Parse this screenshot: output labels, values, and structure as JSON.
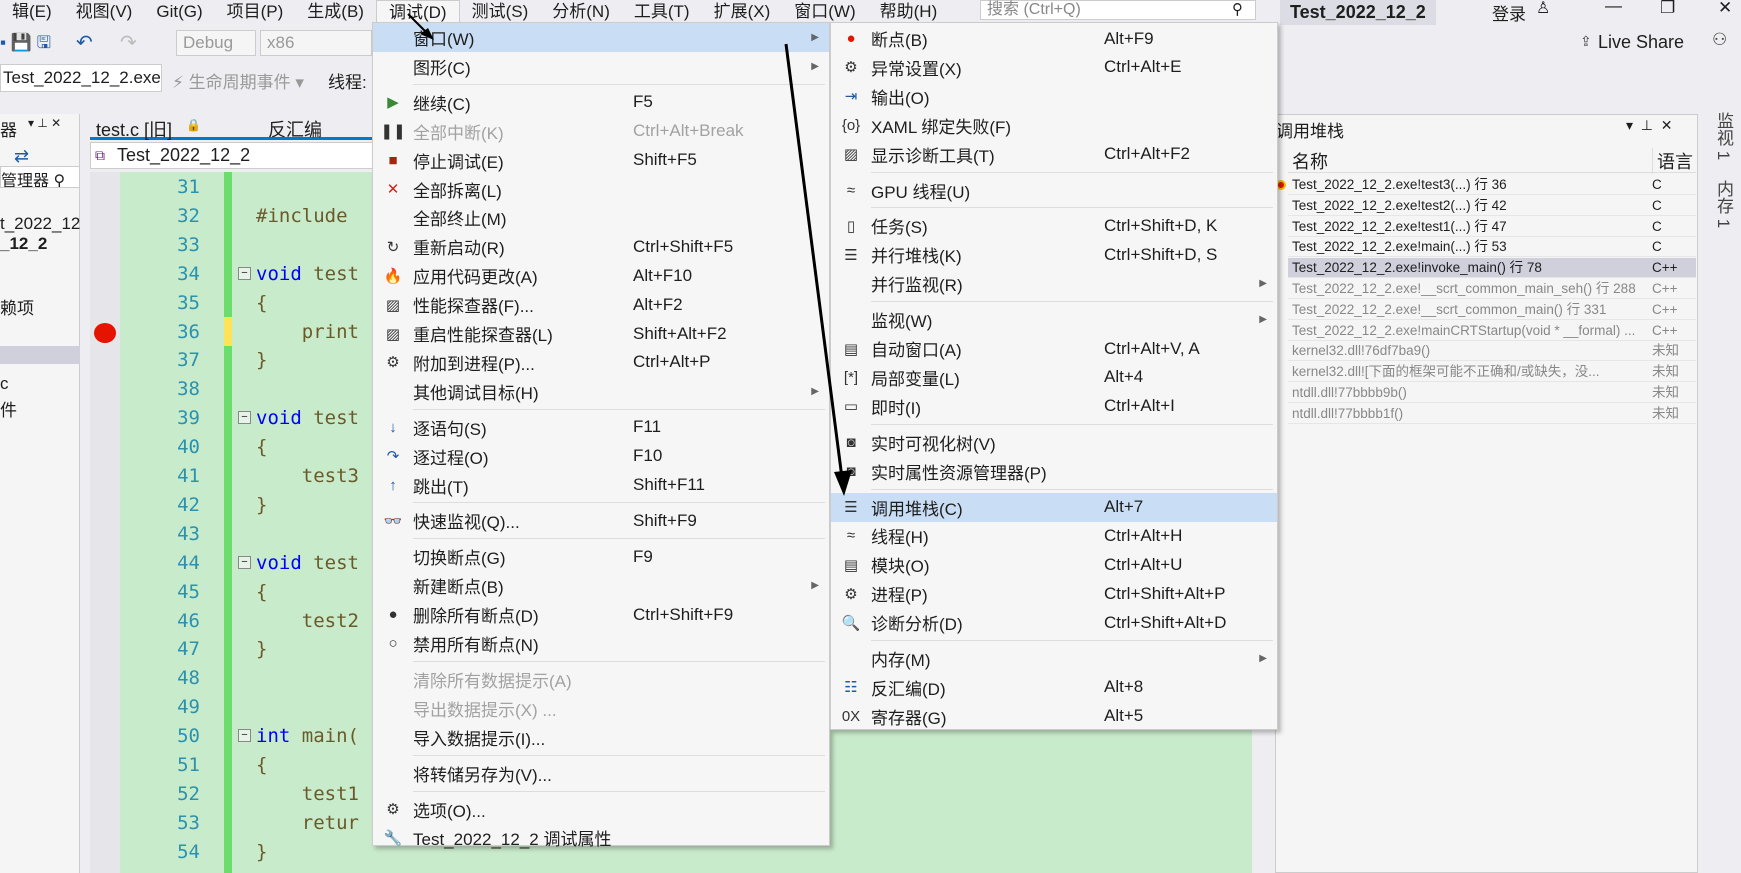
{
  "menubar": {
    "items": [
      "辑(E)",
      "视图(V)",
      "Git(G)",
      "项目(P)",
      "生成(B)",
      "调试(D)",
      "测试(S)",
      "分析(N)",
      "工具(T)",
      "扩展(X)",
      "窗口(W)",
      "帮助(H)"
    ],
    "search_placeholder": "搜索 (Ctrl+Q)"
  },
  "window": {
    "title": "Test_2022_12_2",
    "login": "登录",
    "live_share": "Live Share"
  },
  "toolbar": {
    "config": "Debug",
    "platform": "x86",
    "process": "Test_2022_12_2.exe",
    "lifecycle": "生命周期事件",
    "thread_label": "线程:"
  },
  "left_panel": {
    "title": "器",
    "search": "管理器",
    "items": [
      "t_2022_12",
      "_12_2",
      "赖项",
      "c",
      "件"
    ]
  },
  "editor": {
    "tab": "test.c [旧]",
    "tab2": "反汇编",
    "nav": "Test_2022_12_2",
    "lines": [
      {
        "n": "31",
        "t": ""
      },
      {
        "n": "32",
        "t": "#include"
      },
      {
        "n": "33",
        "t": ""
      },
      {
        "n": "34",
        "k": "void",
        "t": " test"
      },
      {
        "n": "35",
        "t": "{"
      },
      {
        "n": "36",
        "t": "    print"
      },
      {
        "n": "37",
        "t": "}"
      },
      {
        "n": "38",
        "t": ""
      },
      {
        "n": "39",
        "k": "void",
        "t": " test"
      },
      {
        "n": "40",
        "t": "{"
      },
      {
        "n": "41",
        "t": "    test3"
      },
      {
        "n": "42",
        "t": "}"
      },
      {
        "n": "43",
        "t": ""
      },
      {
        "n": "44",
        "k": "void",
        "t": " test"
      },
      {
        "n": "45",
        "t": "{"
      },
      {
        "n": "46",
        "t": "    test2"
      },
      {
        "n": "47",
        "t": "}"
      },
      {
        "n": "48",
        "t": ""
      },
      {
        "n": "49",
        "t": ""
      },
      {
        "n": "50",
        "k": "int",
        "t": " main("
      },
      {
        "n": "51",
        "t": "{"
      },
      {
        "n": "52",
        "t": "    test1"
      },
      {
        "n": "53",
        "t": "    retur"
      },
      {
        "n": "54",
        "t": "}"
      }
    ],
    "breakpoint_line": "36"
  },
  "debug_menu": [
    {
      "label": "窗口(W)",
      "sub": true,
      "hl": true
    },
    {
      "label": "图形(C)",
      "sub": true
    },
    {
      "sep": true
    },
    {
      "label": "继续(C)",
      "sc": "F5",
      "icon": "▶",
      "ic": "#388a34"
    },
    {
      "label": "全部中断(K)",
      "sc": "Ctrl+Alt+Break",
      "icon": "❚❚",
      "dis": true
    },
    {
      "label": "停止调试(E)",
      "sc": "Shift+F5",
      "icon": "■",
      "ic": "#a1260d"
    },
    {
      "label": "全部拆离(L)",
      "icon": "✕",
      "ic": "#c42b1c"
    },
    {
      "label": "全部终止(M)"
    },
    {
      "label": "重新启动(R)",
      "sc": "Ctrl+Shift+F5",
      "icon": "↻"
    },
    {
      "label": "应用代码更改(A)",
      "sc": "Alt+F10",
      "icon": "🔥",
      "ic": "#e05020"
    },
    {
      "label": "性能探查器(F)...",
      "sc": "Alt+F2",
      "icon": "▨"
    },
    {
      "label": "重启性能探查器(L)",
      "sc": "Shift+Alt+F2",
      "icon": "▨"
    },
    {
      "label": "附加到进程(P)...",
      "sc": "Ctrl+Alt+P",
      "icon": "⚙"
    },
    {
      "label": "其他调试目标(H)",
      "sub": true
    },
    {
      "sep": true
    },
    {
      "label": "逐语句(S)",
      "sc": "F11",
      "icon": "↓",
      "ic": "#1e5aa8"
    },
    {
      "label": "逐过程(O)",
      "sc": "F10",
      "icon": "↷",
      "ic": "#1e5aa8"
    },
    {
      "label": "跳出(T)",
      "sc": "Shift+F11",
      "icon": "↑",
      "ic": "#1e5aa8"
    },
    {
      "sep": true
    },
    {
      "label": "快速监视(Q)...",
      "sc": "Shift+F9",
      "icon": "👓"
    },
    {
      "sep": true
    },
    {
      "label": "切换断点(G)",
      "sc": "F9"
    },
    {
      "label": "新建断点(B)",
      "sub": true
    },
    {
      "label": "删除所有断点(D)",
      "sc": "Ctrl+Shift+F9",
      "icon": "●"
    },
    {
      "label": "禁用所有断点(N)",
      "icon": "○"
    },
    {
      "sep": true
    },
    {
      "label": "清除所有数据提示(A)",
      "dis": true
    },
    {
      "label": "导出数据提示(X) ...",
      "dis": true
    },
    {
      "label": "导入数据提示(I)..."
    },
    {
      "sep": true
    },
    {
      "label": "将转储另存为(V)..."
    },
    {
      "sep": true
    },
    {
      "label": "选项(O)...",
      "icon": "⚙"
    },
    {
      "label": "Test_2022_12_2 调试属性",
      "icon": "🔧"
    }
  ],
  "window_submenu": [
    {
      "label": "断点(B)",
      "sc": "Alt+F9",
      "icon": "●",
      "ic": "#e51400"
    },
    {
      "label": "异常设置(X)",
      "sc": "Ctrl+Alt+E",
      "icon": "⚙"
    },
    {
      "label": "输出(O)",
      "icon": "⇥",
      "ic": "#1e5aa8"
    },
    {
      "label": "XAML 绑定失败(F)",
      "icon": "{o}"
    },
    {
      "label": "显示诊断工具(T)",
      "sc": "Ctrl+Alt+F2",
      "icon": "▨"
    },
    {
      "sep": true
    },
    {
      "label": "GPU 线程(U)",
      "icon": "≈"
    },
    {
      "sep": true
    },
    {
      "label": "任务(S)",
      "sc": "Ctrl+Shift+D, K",
      "icon": "▯"
    },
    {
      "label": "并行堆栈(K)",
      "sc": "Ctrl+Shift+D, S",
      "icon": "☰"
    },
    {
      "label": "并行监视(R)",
      "sub": true
    },
    {
      "sep": true
    },
    {
      "label": "监视(W)",
      "sub": true
    },
    {
      "label": "自动窗口(A)",
      "sc": "Ctrl+Alt+V, A",
      "icon": "▤"
    },
    {
      "label": "局部变量(L)",
      "sc": "Alt+4",
      "icon": "[*]"
    },
    {
      "label": "即时(I)",
      "sc": "Ctrl+Alt+I",
      "icon": "▭"
    },
    {
      "sep": true
    },
    {
      "label": "实时可视化树(V)",
      "icon": "◙"
    },
    {
      "label": "实时属性资源管理器(P)",
      "icon": "◙"
    },
    {
      "sep": true
    },
    {
      "label": "调用堆栈(C)",
      "sc": "Alt+7",
      "icon": "☰",
      "hl": true
    },
    {
      "label": "线程(H)",
      "sc": "Ctrl+Alt+H",
      "icon": "≈"
    },
    {
      "label": "模块(O)",
      "sc": "Ctrl+Alt+U",
      "icon": "▤"
    },
    {
      "label": "进程(P)",
      "sc": "Ctrl+Shift+Alt+P",
      "icon": "⚙"
    },
    {
      "label": "诊断分析(D)",
      "sc": "Ctrl+Shift+Alt+D",
      "icon": "🔍"
    },
    {
      "sep": true
    },
    {
      "label": "内存(M)",
      "sub": true
    },
    {
      "label": "反汇编(D)",
      "sc": "Alt+8",
      "icon": "☷",
      "ic": "#1e5aa8"
    },
    {
      "label": "寄存器(G)",
      "sc": "Alt+5",
      "icon": "0X"
    }
  ],
  "callstack": {
    "title": "调用堆栈",
    "col_name": "名称",
    "col_lang": "语言",
    "rows": [
      {
        "name": "Test_2022_12_2.exe!test3(...) 行 36",
        "lang": "C",
        "state": "current"
      },
      {
        "name": "Test_2022_12_2.exe!test2(...) 行 42",
        "lang": "C"
      },
      {
        "name": "Test_2022_12_2.exe!test1(...) 行 47",
        "lang": "C"
      },
      {
        "name": "Test_2022_12_2.exe!main(...) 行 53",
        "lang": "C"
      },
      {
        "name": "Test_2022_12_2.exe!invoke_main() 行 78",
        "lang": "C++",
        "state": "selected"
      },
      {
        "name": "Test_2022_12_2.exe!__scrt_common_main_seh() 行 288",
        "lang": "C++",
        "state": "gray"
      },
      {
        "name": "Test_2022_12_2.exe!__scrt_common_main() 行 331",
        "lang": "C++",
        "state": "gray"
      },
      {
        "name": "Test_2022_12_2.exe!mainCRTStartup(void * __formal) ...",
        "lang": "C++",
        "state": "gray"
      },
      {
        "name": "kernel32.dll!76df7ba9()",
        "lang": "未知",
        "state": "gray"
      },
      {
        "name": "kernel32.dll![下面的框架可能不正确和/或缺失，没...",
        "lang": "未知",
        "state": "gray"
      },
      {
        "name": "ntdll.dll!77bbbb9b()",
        "lang": "未知",
        "state": "gray"
      },
      {
        "name": "ntdll.dll!77bbbb1f()",
        "lang": "未知",
        "state": "gray"
      }
    ]
  },
  "right_tabs": [
    "监视 1",
    "内存 1"
  ]
}
